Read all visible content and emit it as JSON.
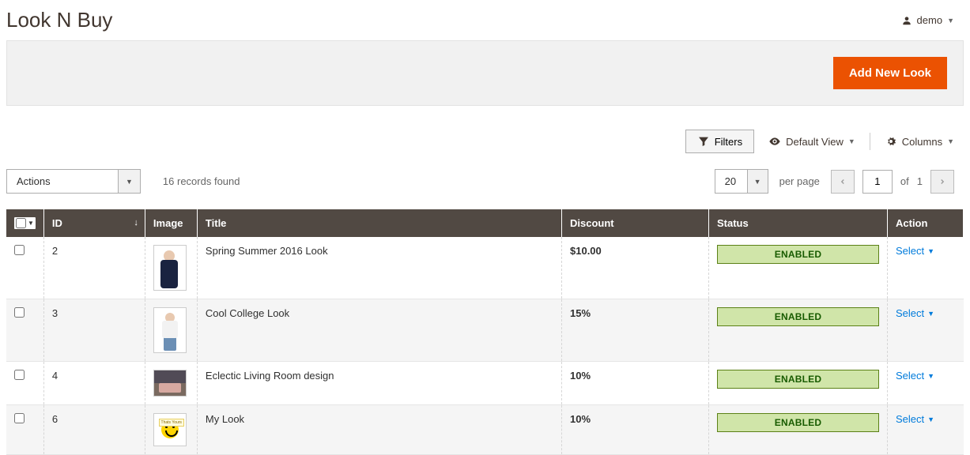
{
  "header": {
    "page_title": "Look N Buy",
    "user_name": "demo"
  },
  "action_bar": {
    "add_new": "Add New Look"
  },
  "toolbar": {
    "filters_label": "Filters",
    "default_view_label": "Default View",
    "columns_label": "Columns",
    "actions_label": "Actions",
    "records_found": "16 records found",
    "per_page_value": "20",
    "per_page_label": "per page",
    "page_current": "1",
    "page_of_label": "of",
    "page_total": "1"
  },
  "columns": {
    "id": "ID",
    "image": "Image",
    "title": "Title",
    "discount": "Discount",
    "status": "Status",
    "action": "Action"
  },
  "rows": [
    {
      "id": "2",
      "title": "Spring Summer 2016 Look",
      "discount": "$10.00",
      "status": "ENABLED",
      "action": "Select"
    },
    {
      "id": "3",
      "title": "Cool College Look",
      "discount": "15%",
      "status": "ENABLED",
      "action": "Select"
    },
    {
      "id": "4",
      "title": "Eclectic Living Room design",
      "discount": "10%",
      "status": "ENABLED",
      "action": "Select"
    },
    {
      "id": "6",
      "title": "My Look",
      "discount": "10%",
      "status": "ENABLED",
      "action": "Select"
    }
  ]
}
